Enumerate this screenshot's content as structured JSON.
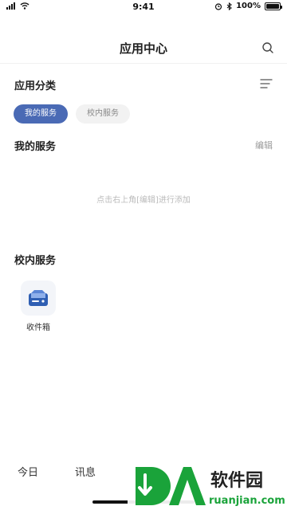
{
  "status_bar": {
    "time": "9:41",
    "battery": "100%"
  },
  "header": {
    "title": "应用中心"
  },
  "category": {
    "title": "应用分类"
  },
  "tabs": [
    {
      "label": "我的服务",
      "active": true
    },
    {
      "label": "校内服务",
      "active": false
    }
  ],
  "my_services": {
    "title": "我的服务",
    "edit_label": "编辑",
    "empty_hint": "点击右上角[编辑]进行添加"
  },
  "campus_services": {
    "title": "校内服务",
    "apps": [
      {
        "label": "收件箱",
        "icon": "inbox-icon"
      }
    ]
  },
  "tabbar": {
    "items": [
      {
        "label": "今日"
      },
      {
        "label": "讯息"
      }
    ]
  },
  "watermark": {
    "brand": "软件园",
    "domain": "ruanjian.com"
  },
  "colors": {
    "accent": "#4a6ab5",
    "watermark_green": "#1aa33a"
  }
}
